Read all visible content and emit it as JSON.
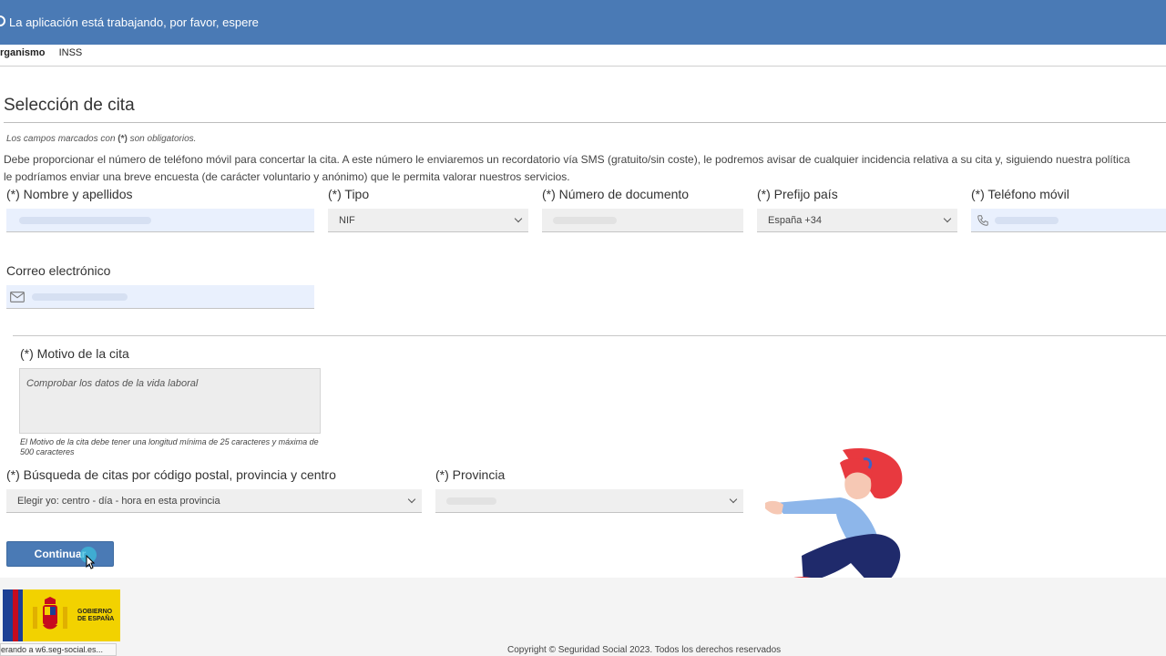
{
  "banner": {
    "message": "La aplicación está trabajando, por favor, espere"
  },
  "organismo": {
    "label": "rganismo",
    "value": "INSS"
  },
  "page": {
    "title": "Selección de cita",
    "required_note_prefix": "Los campos marcados con ",
    "required_note_mark": "(*)",
    "required_note_suffix": " son obligatorios.",
    "description_line1": "Debe proporcionar el número de teléfono móvil para concertar la cita. A este número le enviaremos un recordatorio vía SMS (gratuito/sin coste), le podremos avisar de cualquier incidencia relativa a su cita y, siguiendo nuestra política",
    "description_line2": "le podríamos enviar una breve encuesta (de carácter voluntario y anónimo) que le permita valorar nuestros servicios."
  },
  "form": {
    "name_label": "(*) Nombre y apellidos",
    "type_label": "(*) Tipo",
    "type_value": "NIF",
    "doc_label": "(*) Número de documento",
    "prefix_label": "(*) Prefijo país",
    "prefix_value": "España +34",
    "phone_label": "(*) Teléfono móvil",
    "email_label": "Correo electrónico",
    "reason_label": "(*) Motivo de la cita",
    "reason_value": "Comprobar los datos de la vida laboral",
    "reason_hint": "El Motivo de la cita debe tener una longitud mínima de 25 caracteres y máxima de 500 caracteres",
    "search_label": "(*) Búsqueda de citas por código postal, provincia y centro",
    "search_value": "Elegir yo: centro - día - hora en esta provincia",
    "province_label": "(*) Provincia",
    "continue_button": "Continuar"
  },
  "footer": {
    "copyright": "Copyright © Seguridad Social 2023. Todos los derechos reservados",
    "logo_text_line1": "GOBIERNO",
    "logo_text_line2": "DE ESPAÑA",
    "status_text": "erando a w6.seg-social.es..."
  },
  "colors": {
    "accent": "#4a7ab5",
    "field_blue": "#e9f0fd",
    "field_grey": "#efefef"
  }
}
